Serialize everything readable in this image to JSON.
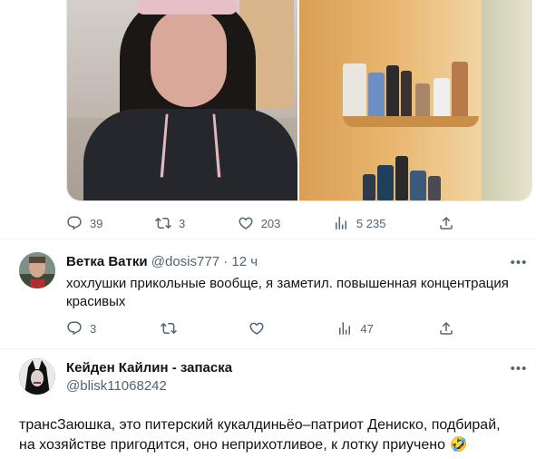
{
  "top_tweet": {
    "stats": {
      "replies": "39",
      "retweets": "3",
      "likes": "203",
      "views": "5 235"
    }
  },
  "reply1": {
    "display_name": "Ветка Ватки",
    "handle": "@dosis777",
    "separator": "·",
    "time": "12 ч",
    "text_line1": "хохлушки прикольные вообще, я заметил. повышенная концентрация",
    "text_line2": "красивых",
    "stats": {
      "replies": "3",
      "retweets": "",
      "likes": "",
      "views": "47"
    }
  },
  "reply2": {
    "display_name": "Кейден Кайлин - запаска",
    "handle": "@blisk11068242",
    "text_line1": "трансЗаюшка, это питерский кукалдиньёо–патриот Дениско, подбирай,",
    "text_line2": "на хозяйстве пригодится, оно неприхотливое, к лотку приучено 🤣"
  },
  "icons": {
    "reply": "reply-icon",
    "retweet": "retweet-icon",
    "like": "heart-icon",
    "views": "views-icon",
    "share": "share-icon",
    "more": "more-icon"
  },
  "colors": {
    "text": "#0f1419",
    "secondary": "#536471",
    "divider": "#eff3f4"
  }
}
